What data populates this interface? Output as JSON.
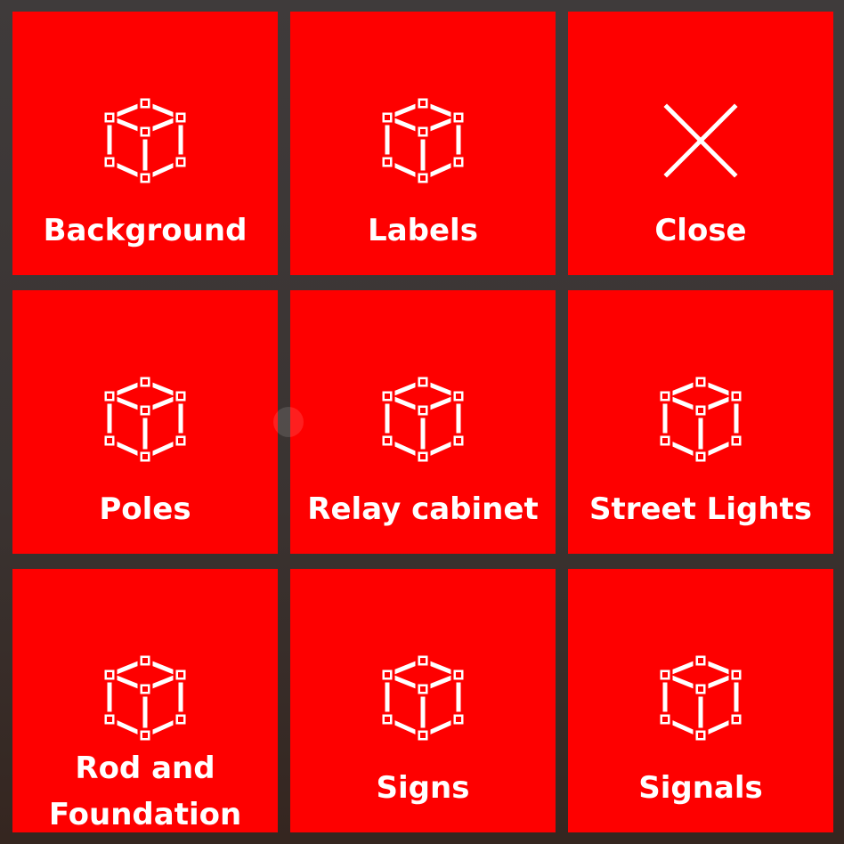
{
  "menu": {
    "tiles": [
      {
        "label": "Background",
        "icon": "cube-icon"
      },
      {
        "label": "Labels",
        "icon": "cube-icon"
      },
      {
        "label": "Close",
        "icon": "close-icon"
      },
      {
        "label": "Poles",
        "icon": "cube-icon"
      },
      {
        "label": "Relay cabinet",
        "icon": "cube-icon"
      },
      {
        "label": "Street Lights",
        "icon": "cube-icon"
      },
      {
        "label": "Rod and Foundation",
        "icon": "cube-icon"
      },
      {
        "label": "Signs",
        "icon": "cube-icon"
      },
      {
        "label": "Signals",
        "icon": "cube-icon"
      }
    ]
  },
  "colors": {
    "tile": "#fe0000",
    "text": "#ffffff",
    "background": "#3c3634"
  }
}
